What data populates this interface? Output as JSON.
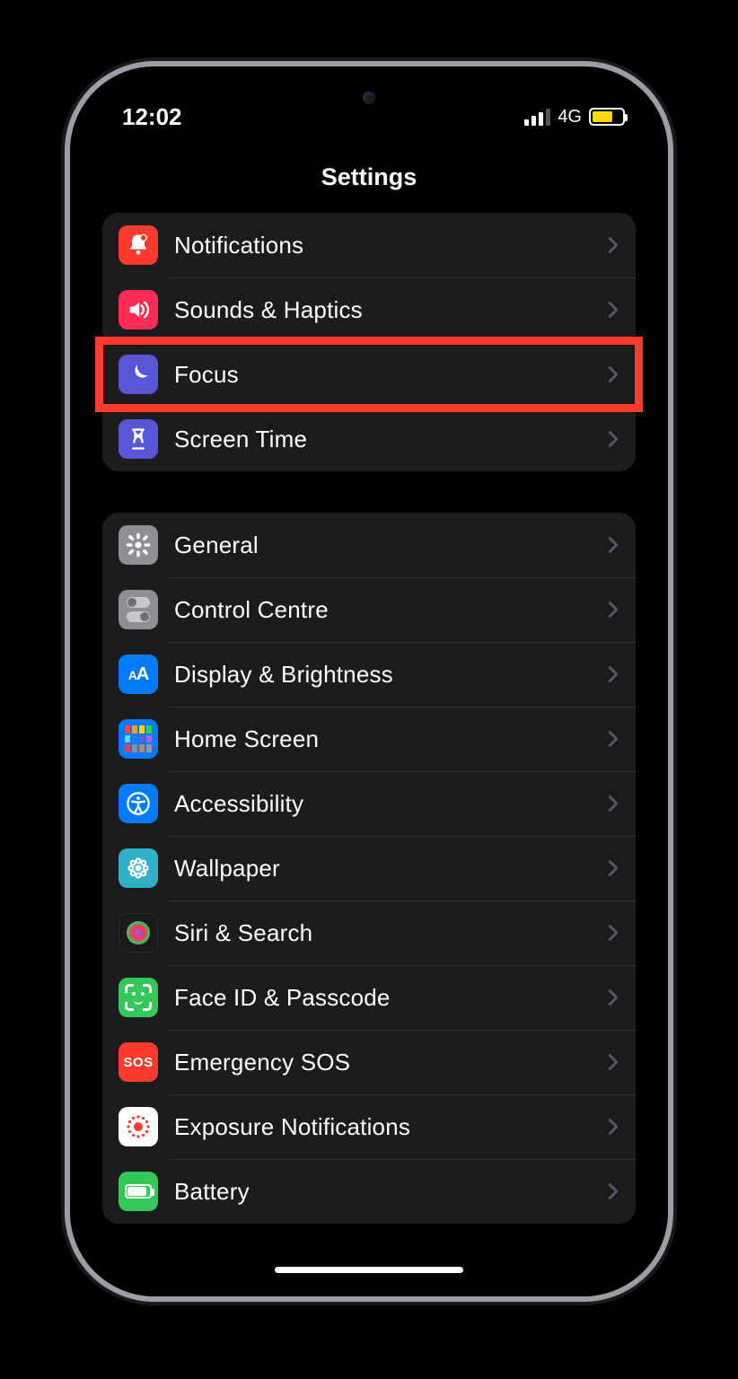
{
  "statusbar": {
    "time": "12:02",
    "network_label": "4G"
  },
  "header": {
    "title": "Settings"
  },
  "groups": [
    {
      "rows": [
        {
          "key": "notifications",
          "label": "Notifications",
          "icon": "bell-icon",
          "bg": "bg-red"
        },
        {
          "key": "sounds",
          "label": "Sounds & Haptics",
          "icon": "speaker-icon",
          "bg": "bg-pink"
        },
        {
          "key": "focus",
          "label": "Focus",
          "icon": "moon-icon",
          "bg": "bg-indigo",
          "highlighted": true
        },
        {
          "key": "screentime",
          "label": "Screen Time",
          "icon": "hourglass-icon",
          "bg": "bg-indigo"
        }
      ]
    },
    {
      "rows": [
        {
          "key": "general",
          "label": "General",
          "icon": "gear-icon",
          "bg": "bg-gray"
        },
        {
          "key": "controlcentre",
          "label": "Control Centre",
          "icon": "toggles-icon",
          "bg": "bg-gray"
        },
        {
          "key": "display",
          "label": "Display & Brightness",
          "icon": "textsize-icon",
          "bg": "bg-blue"
        },
        {
          "key": "homescreen",
          "label": "Home Screen",
          "icon": "grid-icon",
          "bg": "bg-blue"
        },
        {
          "key": "accessibility",
          "label": "Accessibility",
          "icon": "accessibility-icon",
          "bg": "bg-blue"
        },
        {
          "key": "wallpaper",
          "label": "Wallpaper",
          "icon": "flower-icon",
          "bg": "bg-teal"
        },
        {
          "key": "siri",
          "label": "Siri & Search",
          "icon": "siri-icon",
          "bg": "bg-black"
        },
        {
          "key": "faceid",
          "label": "Face ID & Passcode",
          "icon": "faceid-icon",
          "bg": "bg-green"
        },
        {
          "key": "sos",
          "label": "Emergency SOS",
          "icon": "sos-icon",
          "bg": "bg-red",
          "text": "SOS"
        },
        {
          "key": "exposure",
          "label": "Exposure Notifications",
          "icon": "exposure-icon",
          "bg": "bg-white"
        },
        {
          "key": "battery",
          "label": "Battery",
          "icon": "battery-icon",
          "bg": "bg-green"
        }
      ]
    }
  ]
}
